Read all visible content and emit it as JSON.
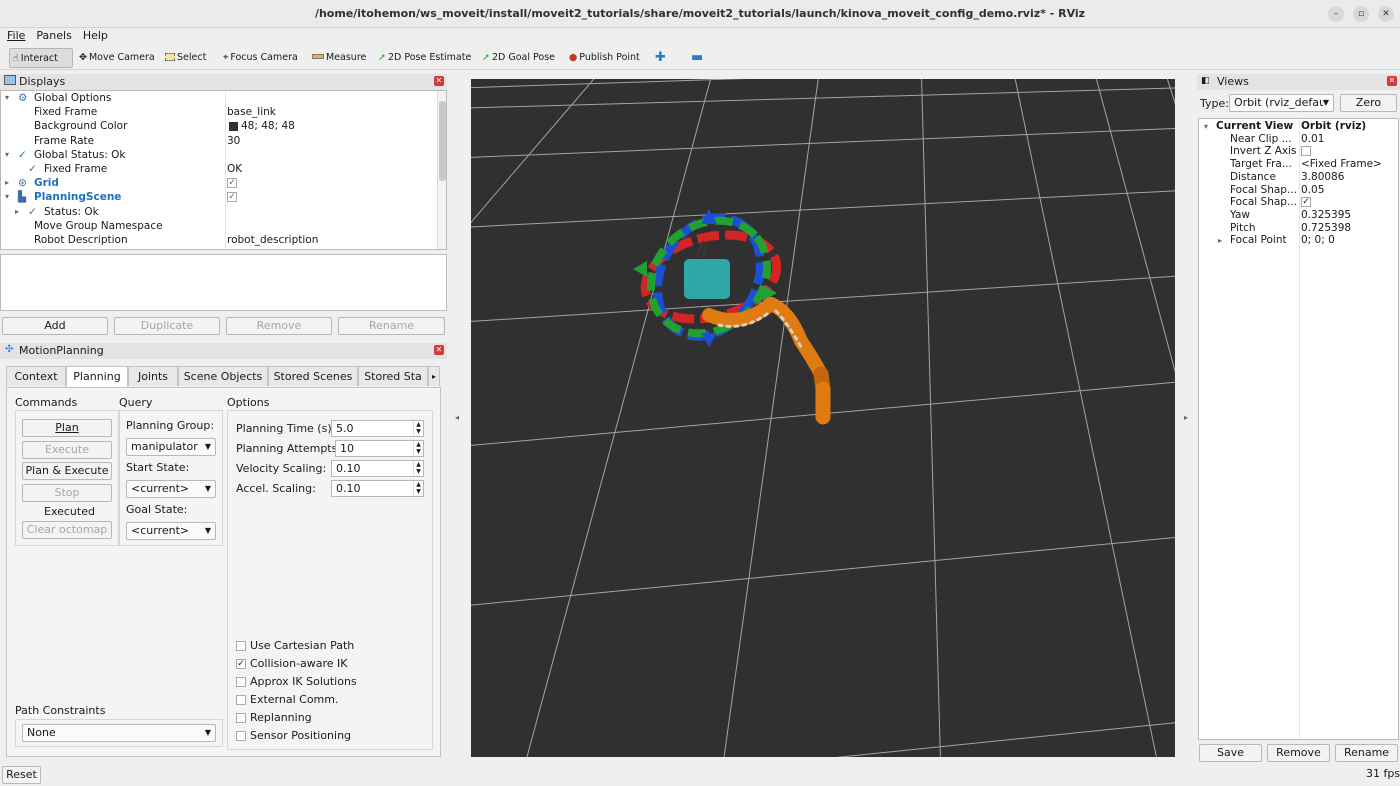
{
  "window": {
    "title": "/home/itohemon/ws_moveit/install/moveit2_tutorials/share/moveit2_tutorials/launch/kinova_moveit_config_demo.rviz* - RViz",
    "minimize": "–",
    "maximize": "▫",
    "close": "✕"
  },
  "menu": [
    "File",
    "Panels",
    "Help"
  ],
  "toolbar": {
    "interact": "Interact",
    "move_camera": "Move Camera",
    "select": "Select",
    "focus_camera": "Focus Camera",
    "measure": "Measure",
    "pose_estimate": "2D Pose Estimate",
    "goal_pose": "2D Goal Pose",
    "publish_point": "Publish Point"
  },
  "displays": {
    "title": "Displays",
    "rows": [
      {
        "arrow": "▾",
        "icon": "⚙",
        "name": "Global Options",
        "value": ""
      },
      {
        "arrow": "",
        "icon": "",
        "name": "Fixed Frame",
        "value": "base_link"
      },
      {
        "arrow": "",
        "icon": "",
        "name": "Background Color",
        "value": "48; 48; 48"
      },
      {
        "arrow": "",
        "icon": "",
        "name": "Frame Rate",
        "value": "30"
      },
      {
        "arrow": "▾",
        "icon": "✓",
        "name": "Global Status: Ok",
        "value": ""
      },
      {
        "arrow": "",
        "icon": "✓",
        "name": "Fixed Frame",
        "value": "OK"
      },
      {
        "arrow": "▸",
        "icon": "⊛",
        "name": "Grid",
        "value": "✓"
      },
      {
        "arrow": "▾",
        "icon": "▙",
        "name": "PlanningScene",
        "value": "✓"
      },
      {
        "arrow": "▸",
        "icon": "✓",
        "name": "Status: Ok",
        "value": ""
      },
      {
        "arrow": "",
        "icon": "",
        "name": "Move Group Namespace",
        "value": ""
      },
      {
        "arrow": "",
        "icon": "",
        "name": "Robot Description",
        "value": "robot_description"
      }
    ],
    "buttons": {
      "add": "Add",
      "duplicate": "Duplicate",
      "remove": "Remove",
      "rename": "Rename"
    }
  },
  "motion": {
    "title": "MotionPlanning",
    "tabs": [
      "Context",
      "Planning",
      "Joints",
      "Scene Objects",
      "Stored Scenes",
      "Stored Sta"
    ],
    "commands": {
      "title": "Commands",
      "plan": "Plan",
      "execute": "Execute",
      "plan_execute": "Plan & Execute",
      "stop": "Stop",
      "executed": "Executed",
      "clear_octomap": "Clear octomap"
    },
    "query": {
      "title": "Query",
      "planning_group_label": "Planning Group:",
      "planning_group": "manipulator",
      "start_state_label": "Start State:",
      "start_state": "<current>",
      "goal_state_label": "Goal State:",
      "goal_state": "<current>"
    },
    "options": {
      "title": "Options",
      "planning_time_label": "Planning Time (s):",
      "planning_time": "5.0",
      "planning_attempts_label": "Planning Attempts:",
      "planning_attempts": "10",
      "velocity_label": "Velocity Scaling:",
      "velocity": "0.10",
      "accel_label": "Accel. Scaling:",
      "accel": "0.10",
      "checks": [
        {
          "label": "Use Cartesian Path",
          "checked": false
        },
        {
          "label": "Collision-aware IK",
          "checked": true
        },
        {
          "label": "Approx IK Solutions",
          "checked": false
        },
        {
          "label": "External Comm.",
          "checked": false
        },
        {
          "label": "Replanning",
          "checked": false
        },
        {
          "label": "Sensor Positioning",
          "checked": false
        }
      ]
    },
    "path_constraints": {
      "title": "Path Constraints",
      "value": "None"
    }
  },
  "views": {
    "title": "Views",
    "type_label": "Type:",
    "type_value": "Orbit (rviz_defau",
    "zero": "Zero",
    "rows": [
      {
        "arrow": "▾",
        "name": "Current View",
        "value": "Orbit (rviz)",
        "bold": true
      },
      {
        "arrow": "",
        "name": "Near Clip ...",
        "value": "0.01"
      },
      {
        "arrow": "",
        "name": "Invert Z Axis",
        "value": ""
      },
      {
        "arrow": "",
        "name": "Target Fra...",
        "value": "<Fixed Frame>"
      },
      {
        "arrow": "",
        "name": "Distance",
        "value": "3.80086"
      },
      {
        "arrow": "",
        "name": "Focal Shap...",
        "value": "0.05"
      },
      {
        "arrow": "",
        "name": "Focal Shap...",
        "value": "✓"
      },
      {
        "arrow": "",
        "name": "Yaw",
        "value": "0.325395"
      },
      {
        "arrow": "",
        "name": "Pitch",
        "value": "0.725398"
      },
      {
        "arrow": "▸",
        "name": "Focal Point",
        "value": "0; 0; 0"
      }
    ],
    "buttons": {
      "save": "Save",
      "remove": "Remove",
      "rename": "Rename"
    }
  },
  "status": {
    "reset": "Reset",
    "fps": "31 fps"
  },
  "colors": {
    "background": "#303030",
    "grid": "#a0a0a0",
    "robot": "#e07b12",
    "accent": "#1f6fbf"
  }
}
